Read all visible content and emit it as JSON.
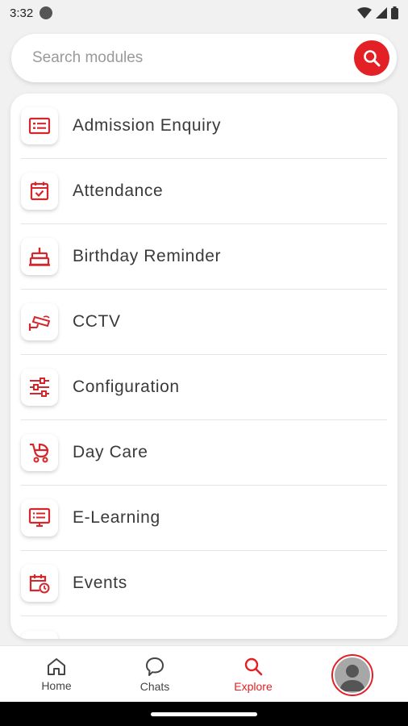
{
  "status_bar": {
    "time": "3:32"
  },
  "search": {
    "placeholder": "Search modules",
    "value": ""
  },
  "modules": [
    {
      "label": "Admission Enquiry",
      "icon": "admission-list-icon"
    },
    {
      "label": "Attendance",
      "icon": "calendar-check-icon"
    },
    {
      "label": "Birthday Reminder",
      "icon": "cake-icon"
    },
    {
      "label": "CCTV",
      "icon": "cctv-camera-icon"
    },
    {
      "label": "Configuration",
      "icon": "sliders-icon"
    },
    {
      "label": "Day Care",
      "icon": "stroller-icon"
    },
    {
      "label": "E-Learning",
      "icon": "monitor-list-icon"
    },
    {
      "label": "Events",
      "icon": "calendar-clock-icon"
    }
  ],
  "nav": {
    "home": "Home",
    "chats": "Chats",
    "explore": "Explore"
  },
  "colors": {
    "accent": "#e32026",
    "icon_red": "#d7262b"
  }
}
